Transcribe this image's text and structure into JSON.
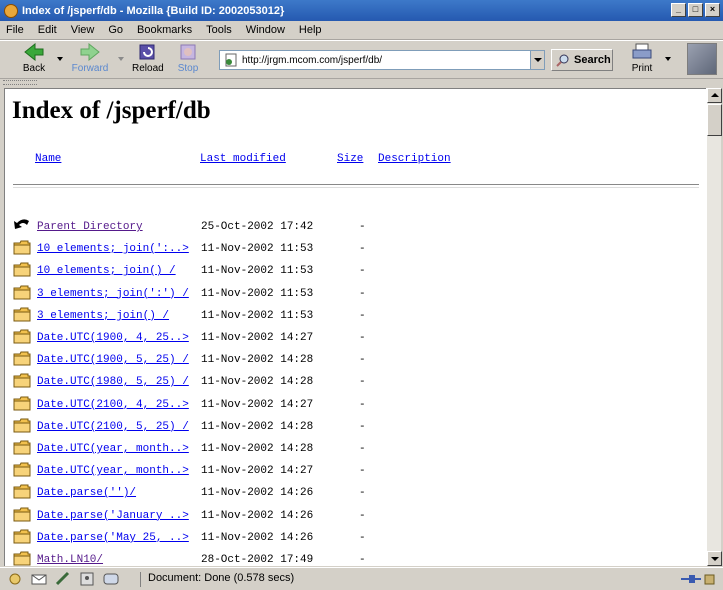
{
  "window": {
    "title": "Index of /jsperf/db - Mozilla {Build ID: 2002053012}",
    "controls": [
      "_",
      "□",
      "×"
    ]
  },
  "menu": [
    "File",
    "Edit",
    "View",
    "Go",
    "Bookmarks",
    "Tools",
    "Window",
    "Help"
  ],
  "toolbar": {
    "back": "Back",
    "forward": "Forward",
    "reload": "Reload",
    "stop": "Stop",
    "search": "Search",
    "print": "Print"
  },
  "address": {
    "url": "http://jrgm.mcom.com/jsperf/db/"
  },
  "page": {
    "heading": "Index of /jsperf/db",
    "columns": {
      "name": "Name",
      "modified": "Last modified",
      "size": "Size",
      "description": "Description"
    },
    "rows": [
      {
        "icon": "back-icon",
        "name": "Parent Directory",
        "date": "25-Oct-2002 17:42",
        "size": "-",
        "visited": true
      },
      {
        "icon": "folder-icon",
        "name": "10 elements; join(':..>",
        "date": "11-Nov-2002 11:53",
        "size": "-",
        "visited": false
      },
      {
        "icon": "folder-icon",
        "name": "10 elements; join() /",
        "date": "11-Nov-2002 11:53",
        "size": "-",
        "visited": false
      },
      {
        "icon": "folder-icon",
        "name": "3 elements; join(':') /",
        "date": "11-Nov-2002 11:53",
        "size": "-",
        "visited": false
      },
      {
        "icon": "folder-icon",
        "name": "3 elements; join() /",
        "date": "11-Nov-2002 11:53",
        "size": "-",
        "visited": false
      },
      {
        "icon": "folder-icon",
        "name": "Date.UTC(1900, 4, 25..>",
        "date": "11-Nov-2002 14:27",
        "size": "-",
        "visited": false
      },
      {
        "icon": "folder-icon",
        "name": "Date.UTC(1900, 5, 25) /",
        "date": "11-Nov-2002 14:28",
        "size": "-",
        "visited": false
      },
      {
        "icon": "folder-icon",
        "name": "Date.UTC(1980, 5, 25) /",
        "date": "11-Nov-2002 14:28",
        "size": "-",
        "visited": false
      },
      {
        "icon": "folder-icon",
        "name": "Date.UTC(2100, 4, 25..>",
        "date": "11-Nov-2002 14:27",
        "size": "-",
        "visited": false
      },
      {
        "icon": "folder-icon",
        "name": "Date.UTC(2100, 5, 25) /",
        "date": "11-Nov-2002 14:28",
        "size": "-",
        "visited": false
      },
      {
        "icon": "folder-icon",
        "name": "Date.UTC(year, month..>",
        "date": "11-Nov-2002 14:28",
        "size": "-",
        "visited": false
      },
      {
        "icon": "folder-icon",
        "name": "Date.UTC(year, month..>",
        "date": "11-Nov-2002 14:27",
        "size": "-",
        "visited": false
      },
      {
        "icon": "folder-icon",
        "name": "Date.parse('')/",
        "date": "11-Nov-2002 14:26",
        "size": "-",
        "visited": false
      },
      {
        "icon": "folder-icon",
        "name": "Date.parse('January ..>",
        "date": "11-Nov-2002 14:26",
        "size": "-",
        "visited": false
      },
      {
        "icon": "folder-icon",
        "name": "Date.parse('May 25, ..>",
        "date": "11-Nov-2002 14:26",
        "size": "-",
        "visited": false
      },
      {
        "icon": "folder-icon",
        "name": "Math.LN10/",
        "date": "28-Oct-2002 17:49",
        "size": "-",
        "visited": true
      }
    ]
  },
  "statusbar": {
    "text": "Document: Done (0.578 secs)"
  }
}
